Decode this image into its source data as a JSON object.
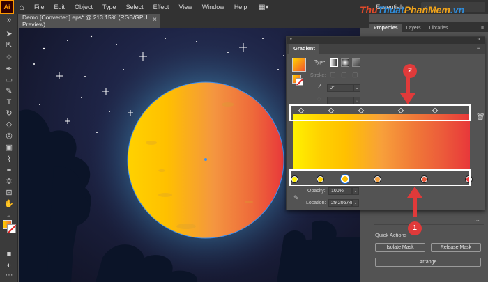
{
  "menu_bar": {
    "app_logo": "Ai",
    "items": [
      "File",
      "Edit",
      "Object",
      "Type",
      "Select",
      "Effect",
      "View",
      "Window",
      "Help"
    ],
    "workspace": "Essentials"
  },
  "watermark": {
    "part_a": "Thu",
    "part_b": "Thuat",
    "part_c": "PhanMem",
    "part_d": ".vn"
  },
  "document_tab": {
    "title": "Demo [Converted].eps* @ 213.15% (RGB/GPU Preview)",
    "close": "×"
  },
  "panel_tabs": {
    "properties": "Properties",
    "layers": "Layers",
    "libraries": "Libraries"
  },
  "gradient_panel": {
    "title": "Gradient",
    "type_label": "Type:",
    "stroke_label": "Stroke:",
    "angle_value": "0°",
    "opacity_label": "Opacity:",
    "opacity_value": "100%",
    "location_label": "Location:",
    "location_value": "29.2067%"
  },
  "gradient_colors": {
    "stops": [
      "#fff200",
      "#ffd200",
      "#ffc000",
      "#f8a03a",
      "#ec5a3a",
      "#e8383a"
    ],
    "selected_stop_index": 2
  },
  "annotations": {
    "label_1": "1",
    "label_2": "2",
    "highlight_color": "#ffffff",
    "arrow_color": "#e03a3a"
  },
  "quick_actions": {
    "title": "Quick Actions",
    "isolate_mask": "Isolate Mask",
    "release_mask": "Release Mask",
    "arrange": "Arrange"
  },
  "icons": {
    "home": "home-icon",
    "workspace_switcher": "workspace-grid-icon",
    "trash": "trash-icon",
    "eyedropper": "eyedropper-icon",
    "angle": "angle-icon",
    "menu": "panel-menu-icon"
  }
}
